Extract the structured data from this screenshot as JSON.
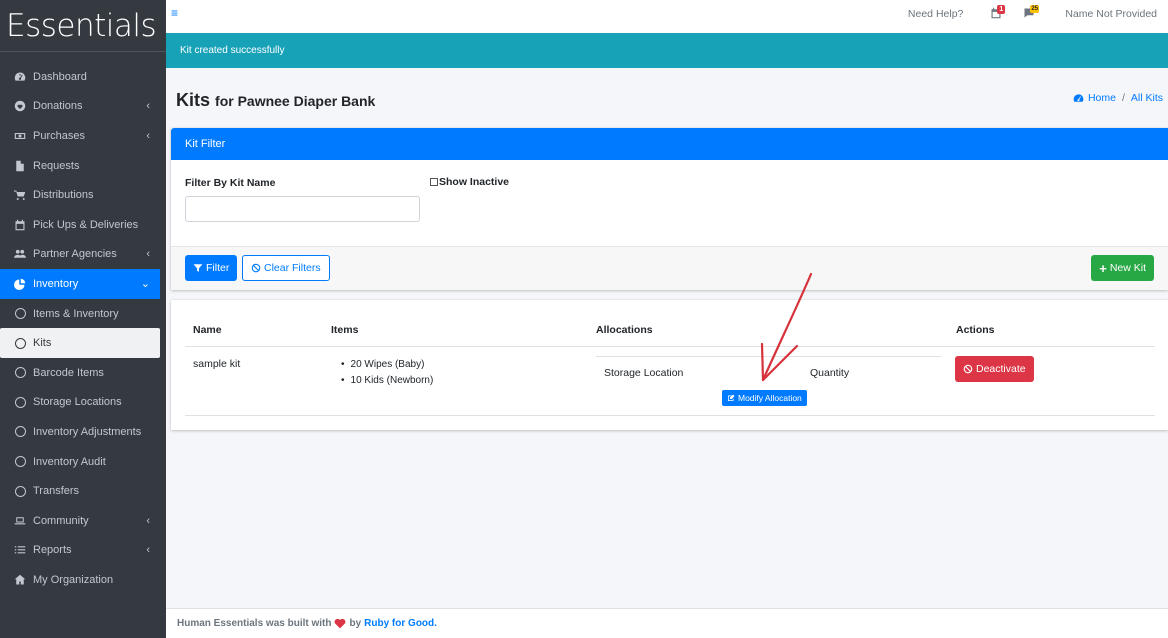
{
  "brand": "Essentials",
  "sidebar": {
    "items": [
      {
        "label": "Dashboard",
        "icon": "tachometer-icon",
        "chevron": false
      },
      {
        "label": "Donations",
        "icon": "heart-icon",
        "chevron": true
      },
      {
        "label": "Purchases",
        "icon": "money-bill-icon",
        "chevron": true
      },
      {
        "label": "Requests",
        "icon": "file-icon",
        "chevron": false
      },
      {
        "label": "Distributions",
        "icon": "cart-icon",
        "chevron": false
      },
      {
        "label": "Pick Ups & Deliveries",
        "icon": "calendar-icon",
        "chevron": false
      },
      {
        "label": "Partner Agencies",
        "icon": "users-icon",
        "chevron": true
      },
      {
        "label": "Inventory",
        "icon": "pie-chart-icon",
        "chevron": true
      },
      {
        "label": "Items & Inventory",
        "icon": "circle-icon"
      },
      {
        "label": "Kits",
        "icon": "circle-icon"
      },
      {
        "label": "Barcode Items",
        "icon": "circle-icon"
      },
      {
        "label": "Storage Locations",
        "icon": "circle-icon"
      },
      {
        "label": "Inventory Adjustments",
        "icon": "circle-icon"
      },
      {
        "label": "Inventory Audit",
        "icon": "circle-icon"
      },
      {
        "label": "Transfers",
        "icon": "circle-icon"
      },
      {
        "label": "Community",
        "icon": "laptop-icon",
        "chevron": true
      },
      {
        "label": "Reports",
        "icon": "list-icon",
        "chevron": true
      },
      {
        "label": "My Organization",
        "icon": "home-icon",
        "chevron": false
      }
    ]
  },
  "topbar": {
    "need_help": "Need Help?",
    "calendar_badge": "1",
    "messages_badge": "25",
    "user_name": "Name Not Provided"
  },
  "alert": {
    "text": "Kit created successfully"
  },
  "header": {
    "title": "Kits",
    "subtitle": "for Pawnee Diaper Bank",
    "breadcrumb_home": "Home",
    "breadcrumb_current": "All Kits",
    "breadcrumb_sep": "/"
  },
  "filter": {
    "header": "Kit Filter",
    "label": "Filter By Kit Name",
    "input_value": "",
    "show_inactive": "Show Inactive",
    "filter_button": "Filter",
    "clear_button": "Clear Filters",
    "new_button": "New Kit"
  },
  "table": {
    "columns": [
      "Name",
      "Items",
      "Allocations",
      "Actions"
    ],
    "rows": [
      {
        "name": "sample kit",
        "items": [
          "20 Wipes (Baby)",
          "10 Kids (Newborn)"
        ],
        "alloc_header_location": "Storage Location",
        "alloc_header_quantity": "Quantity",
        "modify_button": "Modify Allocation",
        "deactivate_button": "Deactivate"
      }
    ]
  },
  "footer": {
    "text_prefix": "Human Essentials was built with",
    "text_by": "by",
    "link": "Ruby for Good."
  },
  "colors": {
    "primary": "#007bff",
    "success": "#28a745",
    "danger": "#dc3545",
    "info": "#17a2b8",
    "sidebar": "#343a40"
  }
}
